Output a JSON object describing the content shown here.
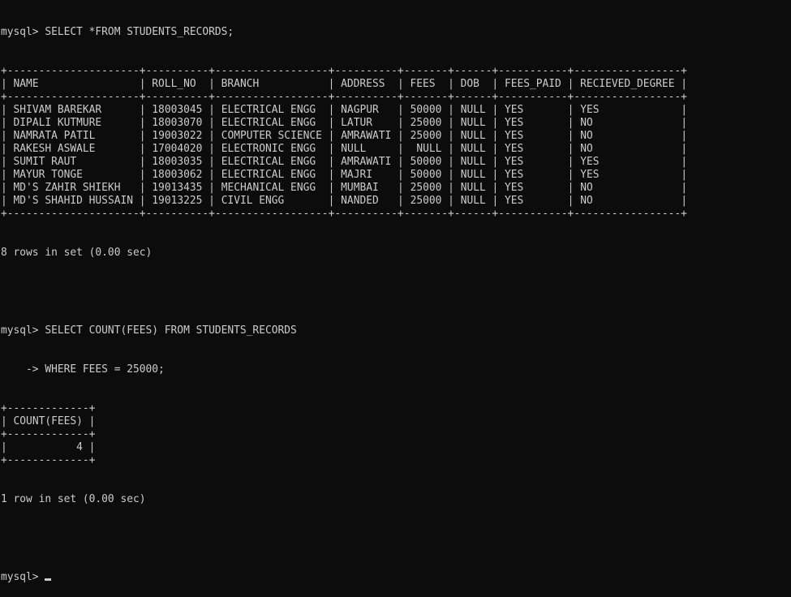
{
  "terminal": {
    "prompt": "mysql> ",
    "query1": "SELECT *FROM STUDENTS_RECORDS;",
    "table1": {
      "columns": [
        "NAME",
        "ROLL_NO",
        "BRANCH",
        "ADDRESS",
        "FEES",
        "DOB",
        "FEES_PAID",
        "RECIEVED_DEGREE"
      ],
      "rows": [
        [
          "SHIVAM BAREKAR",
          "18003045",
          "ELECTRICAL ENGG",
          "NAGPUR",
          "50000",
          "NULL",
          "YES",
          "YES"
        ],
        [
          "DIPALI KUTMURE",
          "18003070",
          "ELECTRICAL ENGG",
          "LATUR",
          "25000",
          "NULL",
          "YES",
          "NO"
        ],
        [
          "NAMRATA PATIL",
          "19003022",
          "COMPUTER SCIENCE",
          "AMRAWATI",
          "25000",
          "NULL",
          "YES",
          "NO"
        ],
        [
          "RAKESH ASWALE",
          "17004020",
          "ELECTRONIC ENGG",
          "NULL",
          "NULL",
          "NULL",
          "YES",
          "NO"
        ],
        [
          "SUMIT RAUT",
          "18003035",
          "ELECTRICAL ENGG",
          "AMRAWATI",
          "50000",
          "NULL",
          "YES",
          "YES"
        ],
        [
          "MAYUR TONGE",
          "18003062",
          "ELECTRICAL ENGG",
          "MAJRI",
          "50000",
          "NULL",
          "YES",
          "YES"
        ],
        [
          "MD'S ZAHIR SHIEKH",
          "19013435",
          "MECHANICAL ENGG",
          "MUMBAI",
          "25000",
          "NULL",
          "YES",
          "NO"
        ],
        [
          "MD'S SHAHID HUSSAIN",
          "19013225",
          "CIVIL ENGG",
          "NANDED",
          "25000",
          "NULL",
          "YES",
          "NO"
        ]
      ]
    },
    "result1": "8 rows in set (0.00 sec)",
    "query2_line1": "SELECT COUNT(FEES) FROM STUDENTS_RECORDS",
    "continuation_prompt": "    -> ",
    "query2_line2": "WHERE FEES = 25000;",
    "table2": {
      "columns": [
        "COUNT(FEES)"
      ],
      "rows": [
        [
          "4"
        ]
      ]
    },
    "result2": "1 row in set (0.00 sec)"
  }
}
